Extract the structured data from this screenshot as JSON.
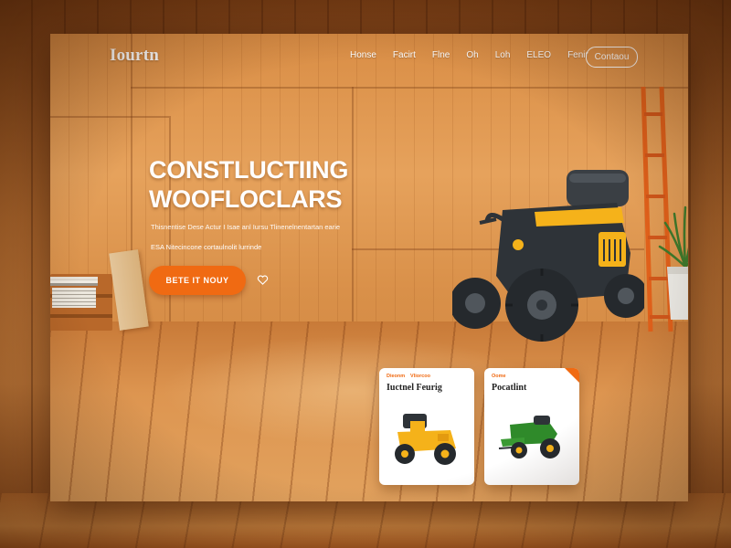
{
  "nav": {
    "logo": "Iourtn",
    "items": [
      "Honse",
      "Facirt",
      "Flne",
      "Oh",
      "Loh",
      "ELEO",
      "Fenir"
    ],
    "contact": "Contaou"
  },
  "hero": {
    "title_line1": "CONSTLUCTIING",
    "title_line2": "WOOFLOCLARS",
    "subtitle_line1": "Thisnentise Dese Actur I Isae anl Iursu Tlinenelnentartan earie",
    "subtitle_line2": "ESA Nitecincone cortaulnolit lurrinde",
    "cta_label": "BETE IT NOUY"
  },
  "cards": [
    {
      "tag1": "Dieonm",
      "tag2": "Vliorcoo",
      "title": "Iuctnel Feurig",
      "image": "yellow-tractor-icon",
      "accent": "#f5b21a"
    },
    {
      "tag1": "Oome",
      "tag2": "",
      "title": "Pocatlint",
      "image": "green-tractor-icon",
      "accent": "#2f8a2a"
    }
  ],
  "colors": {
    "accent": "#f06a12",
    "wood": "#d98d45"
  }
}
